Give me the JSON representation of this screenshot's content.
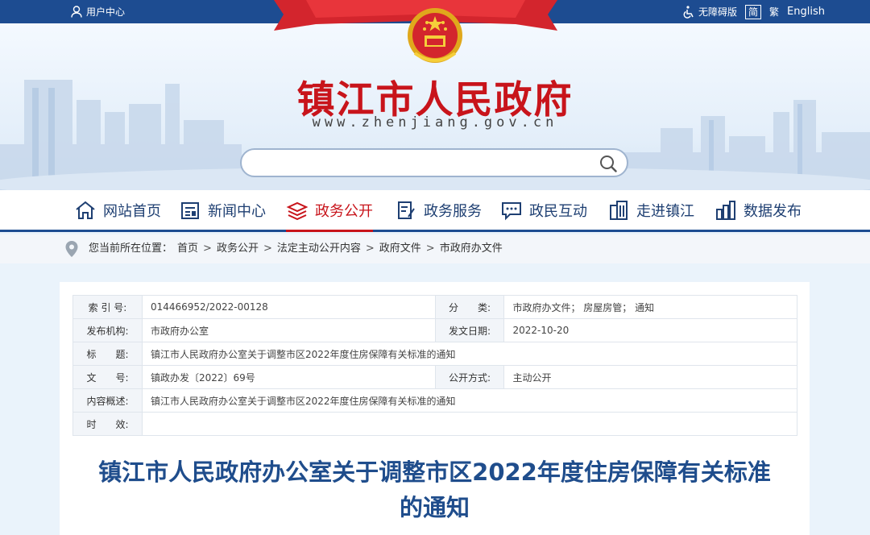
{
  "topbar": {
    "user_center": "用户中心",
    "accessibility": "无障碍版",
    "simplified": "简",
    "traditional": "繁",
    "english": "English"
  },
  "header": {
    "site_title": "镇江市人民政府",
    "site_url": "www.zhenjiang.gov.cn"
  },
  "search": {
    "placeholder": "",
    "value": ""
  },
  "nav": {
    "items": [
      {
        "label": "网站首页",
        "icon": "home-icon"
      },
      {
        "label": "新闻中心",
        "icon": "news-icon"
      },
      {
        "label": "政务公开",
        "icon": "layers-icon",
        "active": true
      },
      {
        "label": "政务服务",
        "icon": "document-edit-icon"
      },
      {
        "label": "政民互动",
        "icon": "chat-icon"
      },
      {
        "label": "走进镇江",
        "icon": "building-icon"
      },
      {
        "label": "数据发布",
        "icon": "bar-chart-icon"
      }
    ]
  },
  "breadcrumb": {
    "prefix": "您当前所在位置：",
    "items": [
      "首页",
      "政务公开",
      "法定主动公开内容",
      "政府文件",
      "市政府办文件"
    ]
  },
  "meta": {
    "index_label": "索 引 号:",
    "index_value": "014466952/2022-00128",
    "category_label": "分　　类:",
    "category_value": "市政府办文件；  房屋房管；  通知",
    "issuer_label": "发布机构:",
    "issuer_value": "市政府办公室",
    "date_label": "发文日期:",
    "date_value": "2022-10-20",
    "title_label": "标　　题:",
    "title_value": "镇江市人民政府办公室关于调整市区2022年度住房保障有关标准的通知",
    "docno_label": "文　　号:",
    "docno_value": "镇政办发〔2022〕69号",
    "disclosure_label": "公开方式:",
    "disclosure_value": "主动公开",
    "summary_label": "内容概述:",
    "summary_value": "镇江市人民政府办公室关于调整市区2022年度住房保障有关标准的通知",
    "validity_label": "时　　效:",
    "validity_value": ""
  },
  "document": {
    "title_line1": "镇江市人民政府办公室关于调整市区2022年度住房保障有关标准",
    "title_line2": "的通知"
  },
  "colors": {
    "primary": "#1d4c91",
    "accent": "#c8141b",
    "title_blue": "#1f4d8c"
  }
}
